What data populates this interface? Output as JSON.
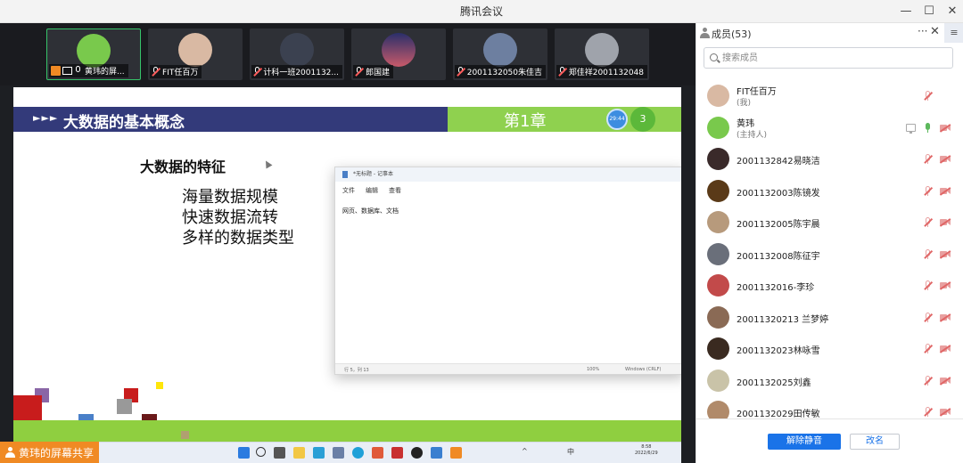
{
  "window": {
    "title": "腾讯会议",
    "minimize": "—",
    "maximize": "☐",
    "close": "✕"
  },
  "video_strip": [
    {
      "name": "黄玮的屏...",
      "avatar_color": "#79c94c",
      "active": true
    },
    {
      "name": "FIT任百万",
      "avatar_color": "#d9b9a3",
      "active": false
    },
    {
      "name": "计科一班2001132...",
      "avatar_color": "#3b4150",
      "active": false
    },
    {
      "name": "郎国建",
      "avatar_color": "#3a3f7a",
      "active": false
    },
    {
      "name": "2001132050朱佳吉",
      "avatar_color": "#6d7fa0",
      "active": false
    },
    {
      "name": "郑佳祥2001132048",
      "avatar_color": "#9fa3ab",
      "active": false
    }
  ],
  "slide": {
    "arrows": "►►►",
    "title": "大数据的基本概念",
    "chapter": "第1章",
    "clock_text": "29:44",
    "page": "3",
    "feature_heading": "大数据的特征",
    "bullets": [
      "海量数据规模",
      "快速数据流转",
      "多样的数据类型"
    ]
  },
  "notepad": {
    "title": "*无标题 - 记事本",
    "menu": [
      "文件",
      "编辑",
      "查看"
    ],
    "content": "网页、数据库、文档",
    "status": {
      "position": "行 5，列 13",
      "zoom": "100%",
      "encoding": "Windows (CRLF)"
    }
  },
  "taskbar": {
    "time": "8:58",
    "date": "2022/6/29",
    "ime": "中"
  },
  "sharer_label": "黄玮的屏幕共享",
  "panel": {
    "title": "成员(53)",
    "more": "···",
    "close": "✕",
    "menu": "≡",
    "search_placeholder": "搜索成员",
    "members": [
      {
        "name": "FIT任百万",
        "sub": "(我)",
        "avatar_color": "#d9b9a3",
        "mic": "off",
        "cam": false,
        "screen": false
      },
      {
        "name": "黄玮",
        "sub": "(主持人)",
        "avatar_color": "#79c94c",
        "mic": "on",
        "cam": true,
        "screen": true
      },
      {
        "name": " 2001132842易晓洁",
        "sub": "",
        "avatar_color": "#3a2a2a",
        "mic": "off",
        "cam": true,
        "screen": false
      },
      {
        "name": "2001132003陈镜发",
        "sub": "",
        "avatar_color": "#5a3a18",
        "mic": "off",
        "cam": true,
        "screen": false
      },
      {
        "name": "2001132005陈宇晨",
        "sub": "",
        "avatar_color": "#b79a7c",
        "mic": "off",
        "cam": true,
        "screen": false
      },
      {
        "name": "2001132008陈征宇",
        "sub": "",
        "avatar_color": "#6a6f7a",
        "mic": "off",
        "cam": true,
        "screen": false
      },
      {
        "name": "2001132016-李珍",
        "sub": "",
        "avatar_color": "#c24a4a",
        "mic": "off",
        "cam": true,
        "screen": false
      },
      {
        "name": "20011320213 兰梦婷",
        "sub": "",
        "avatar_color": "#8a6a55",
        "mic": "off",
        "cam": true,
        "screen": false
      },
      {
        "name": "2001132023林咏雪",
        "sub": "",
        "avatar_color": "#3a2a20",
        "mic": "off",
        "cam": true,
        "screen": false
      },
      {
        "name": "2001132025刘鑫",
        "sub": "",
        "avatar_color": "#c9c3a8",
        "mic": "off",
        "cam": true,
        "screen": false
      },
      {
        "name": "2001132029田传敏",
        "sub": "",
        "avatar_color": "#b08a6a",
        "mic": "off",
        "cam": true,
        "screen": false
      }
    ],
    "unmute_label": "解除静音",
    "rename_label": "改名"
  }
}
